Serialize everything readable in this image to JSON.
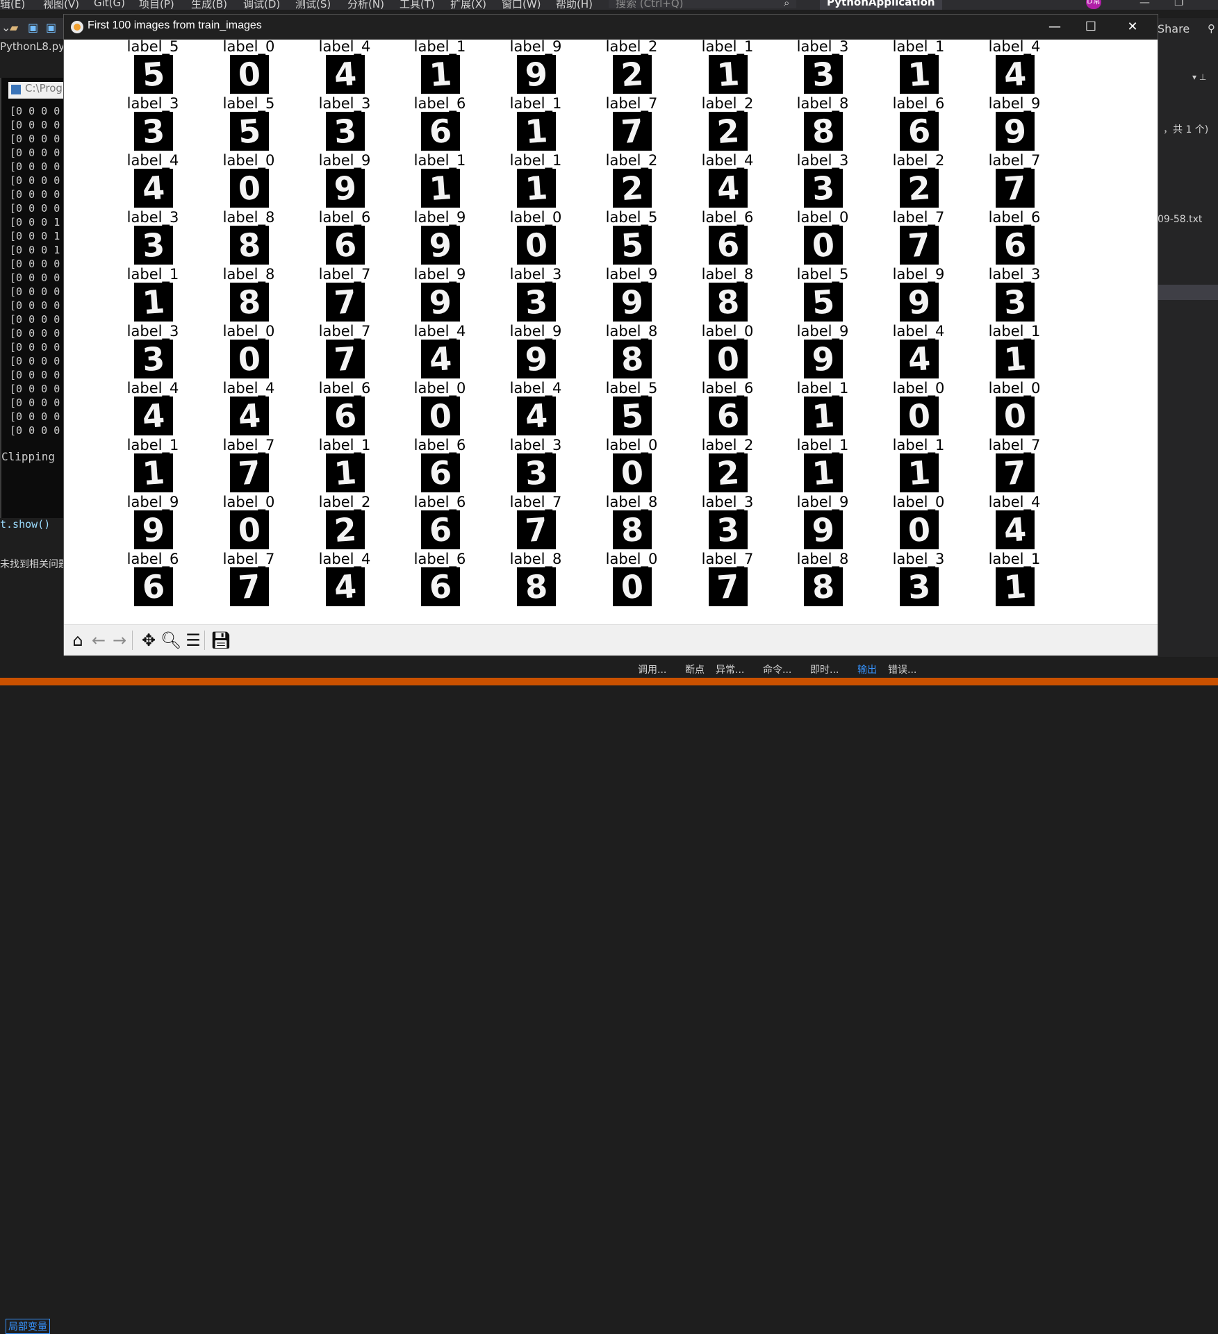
{
  "ide": {
    "menus": [
      "辑(E)",
      "视图(V)",
      "Git(G)",
      "项目(P)",
      "生成(B)",
      "调试(D)",
      "测试(S)",
      "分析(N)",
      "工具(T)",
      "扩展(X)",
      "窗口(W)",
      "帮助(H)"
    ],
    "search_placeholder": "搜索 (Ctrl+Q)",
    "app_title": "PythonApplication",
    "avatar_text": "D常",
    "file_tab": "PythonL8.py",
    "console_title": "C:\\Prog",
    "console_rows": [
      "[0 0 0 0",
      "[0 0 0 0",
      "[0 0 0 0",
      "[0 0 0 0",
      "[0 0 0 0",
      "[0 0 0 0",
      "[0 0 0 0",
      "[0 0 0 0",
      "[0 0 0 1",
      "[0 0 0 1",
      "[0 0 0 1",
      "[0 0 0 0",
      "[0 0 0 0",
      "[0 0 0 0",
      "[0 0 0 0",
      "[0 0 0 0",
      "[0 0 0 0",
      "[0 0 0 0",
      "[0 0 0 0",
      "[0 0 0 0",
      "[0 0 0 0",
      "[0 0 0 0",
      "[0 0 0 0",
      "[0 0 0 0"
    ],
    "clipping_text": "Clipping",
    "code_line": "t.show()",
    "no_match_text": "未找到相关问题",
    "locals_tab": "局部变量",
    "share_label": "Share",
    "right_count_text": "，共 1 个)",
    "right_file_text": "09-58.txt",
    "bottom_tabs": [
      "调用...",
      "断点",
      "异常...",
      "命令...",
      "即时...",
      "输出",
      "错误..."
    ],
    "active_bottom_tab": "输出"
  },
  "window": {
    "title": "First 100 images from train_images",
    "minimize": "—",
    "maximize": "☐",
    "close": "✕"
  },
  "grid": {
    "rows": [
      {
        "labels": [
          "label_5",
          "label_0",
          "label_4",
          "label_1",
          "label_9",
          "label_2",
          "label_1",
          "label_3",
          "label_1",
          "label_4"
        ],
        "digits": [
          "5",
          "0",
          "4",
          "1",
          "9",
          "2",
          "1",
          "3",
          "1",
          "4"
        ]
      },
      {
        "labels": [
          "label_3",
          "label_5",
          "label_3",
          "label_6",
          "label_1",
          "label_7",
          "label_2",
          "label_8",
          "label_6",
          "label_9"
        ],
        "digits": [
          "3",
          "5",
          "3",
          "6",
          "1",
          "7",
          "2",
          "8",
          "6",
          "9"
        ]
      },
      {
        "labels": [
          "label_4",
          "label_0",
          "label_9",
          "label_1",
          "label_1",
          "label_2",
          "label_4",
          "label_3",
          "label_2",
          "label_7"
        ],
        "digits": [
          "4",
          "0",
          "9",
          "1",
          "1",
          "2",
          "4",
          "3",
          "2",
          "7"
        ]
      },
      {
        "labels": [
          "label_3",
          "label_8",
          "label_6",
          "label_9",
          "label_0",
          "label_5",
          "label_6",
          "label_0",
          "label_7",
          "label_6"
        ],
        "digits": [
          "3",
          "8",
          "6",
          "9",
          "0",
          "5",
          "6",
          "0",
          "7",
          "6"
        ]
      },
      {
        "labels": [
          "label_1",
          "label_8",
          "label_7",
          "label_9",
          "label_3",
          "label_9",
          "label_8",
          "label_5",
          "label_9",
          "label_3"
        ],
        "digits": [
          "1",
          "8",
          "7",
          "9",
          "3",
          "9",
          "8",
          "5",
          "9",
          "3"
        ]
      },
      {
        "labels": [
          "label_3",
          "label_0",
          "label_7",
          "label_4",
          "label_9",
          "label_8",
          "label_0",
          "label_9",
          "label_4",
          "label_1"
        ],
        "digits": [
          "3",
          "0",
          "7",
          "4",
          "9",
          "8",
          "0",
          "9",
          "4",
          "1"
        ]
      },
      {
        "labels": [
          "label_4",
          "label_4",
          "label_6",
          "label_0",
          "label_4",
          "label_5",
          "label_6",
          "label_1",
          "label_0",
          "label_0"
        ],
        "digits": [
          "4",
          "4",
          "6",
          "0",
          "4",
          "5",
          "6",
          "1",
          "0",
          "0"
        ]
      },
      {
        "labels": [
          "label_1",
          "label_7",
          "label_1",
          "label_6",
          "label_3",
          "label_0",
          "label_2",
          "label_1",
          "label_1",
          "label_7"
        ],
        "digits": [
          "1",
          "7",
          "1",
          "6",
          "3",
          "0",
          "2",
          "1",
          "1",
          "7"
        ]
      },
      {
        "labels": [
          "label_9",
          "label_0",
          "label_2",
          "label_6",
          "label_7",
          "label_8",
          "label_3",
          "label_9",
          "label_0",
          "label_4"
        ],
        "digits": [
          "9",
          "0",
          "2",
          "6",
          "7",
          "8",
          "3",
          "9",
          "0",
          "4"
        ]
      },
      {
        "labels": [
          "label_6",
          "label_7",
          "label_4",
          "label_6",
          "label_8",
          "label_0",
          "label_7",
          "label_8",
          "label_3",
          "label_1"
        ],
        "digits": [
          "6",
          "7",
          "4",
          "6",
          "8",
          "0",
          "7",
          "8",
          "3",
          "1"
        ]
      }
    ]
  },
  "toolbar": {
    "tools": [
      {
        "name": "home-icon",
        "glyph": "⌂",
        "enabled": true
      },
      {
        "name": "back-arrow-icon",
        "glyph": "←",
        "enabled": false
      },
      {
        "name": "forward-arrow-icon",
        "glyph": "→",
        "enabled": false
      },
      {
        "name": "pan-move-icon",
        "glyph": "✥",
        "enabled": true
      },
      {
        "name": "zoom-magnifier-icon",
        "glyph": "🔍︎",
        "enabled": true
      },
      {
        "name": "configure-subplots-icon",
        "glyph": "☰",
        "enabled": true
      },
      {
        "name": "save-figure-icon",
        "glyph": "💾︎",
        "enabled": true
      }
    ]
  }
}
